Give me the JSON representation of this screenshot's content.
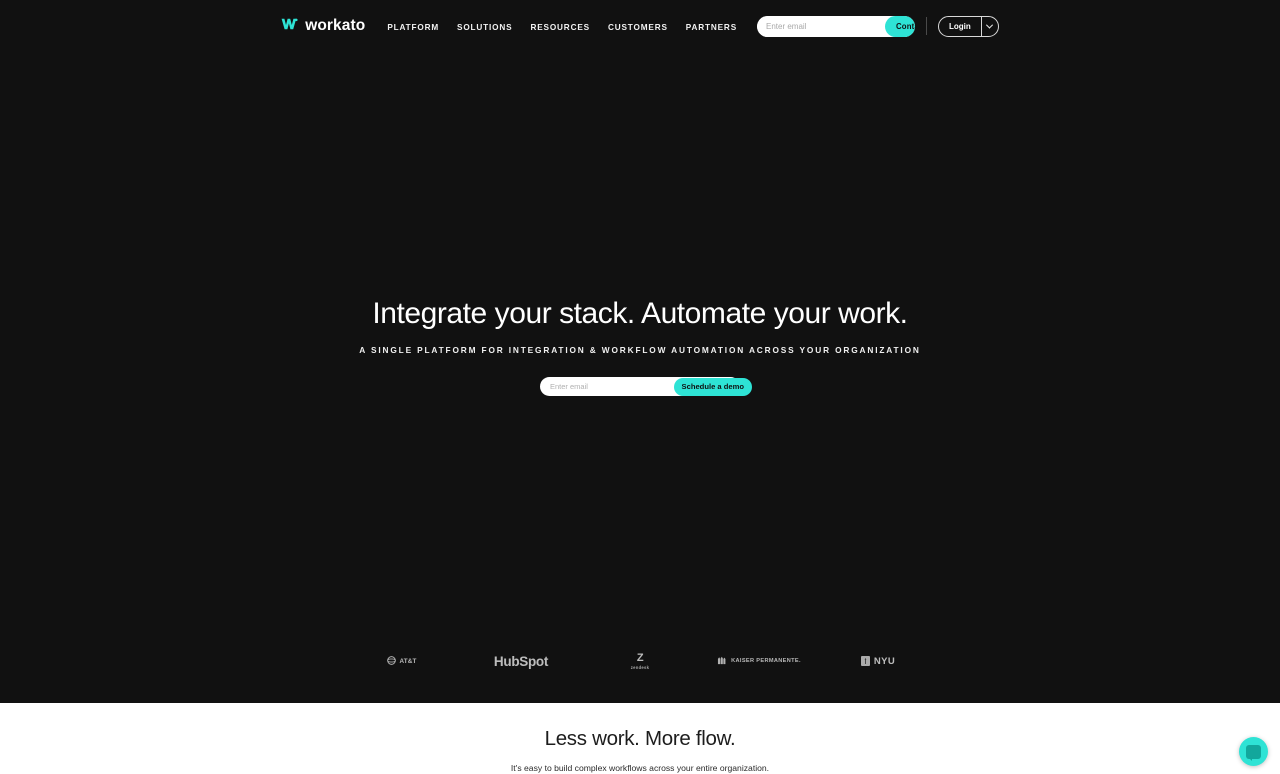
{
  "colors": {
    "accent_teal": "#2ee3d5",
    "hero_background": "#111111",
    "light_background": "#ffffff",
    "chat_icon": "#12a79c"
  },
  "nav": {
    "brand_name": "workato",
    "brand_mark_icon": "workato-w-logo-icon",
    "links": [
      {
        "label": "PLATFORM"
      },
      {
        "label": "SOLUTIONS"
      },
      {
        "label": "RESOURCES"
      },
      {
        "label": "CUSTOMERS"
      },
      {
        "label": "PARTNERS"
      }
    ],
    "email_placeholder": "Enter email",
    "email_value": "",
    "contact_sales_label": "Contact Sales",
    "login_label": "Login",
    "login_caret_icon": "chevron-down-icon"
  },
  "hero": {
    "title": "Integrate your stack. Automate your work.",
    "subtitle": "A SINGLE PLATFORM FOR INTEGRATION & WORKFLOW AUTOMATION ACROSS YOUR ORGANIZATION",
    "email_placeholder": "Enter email",
    "email_value": "",
    "demo_button_label": "Schedule a demo"
  },
  "logos": [
    {
      "name": "AT&T",
      "text": "AT&T",
      "icon": "att-globe-icon"
    },
    {
      "name": "HubSpot",
      "text": "HubSpot",
      "icon": "hubspot-sprocket-icon"
    },
    {
      "name": "Zendesk",
      "text": "zendesk",
      "mark": "Z",
      "icon": "zendesk-mark-icon"
    },
    {
      "name": "Kaiser Permanente",
      "text": "KAISER PERMANENTE.",
      "icon": "kaiser-permanente-icon"
    },
    {
      "name": "NYU",
      "text": "NYU",
      "icon": "nyu-torch-icon"
    }
  ],
  "light_section": {
    "title": "Less work. More flow.",
    "subtitle": "It's easy to build complex workflows across your entire organization."
  },
  "chat": {
    "icon": "chat-bubble-icon",
    "aria_label": "Open chat"
  }
}
